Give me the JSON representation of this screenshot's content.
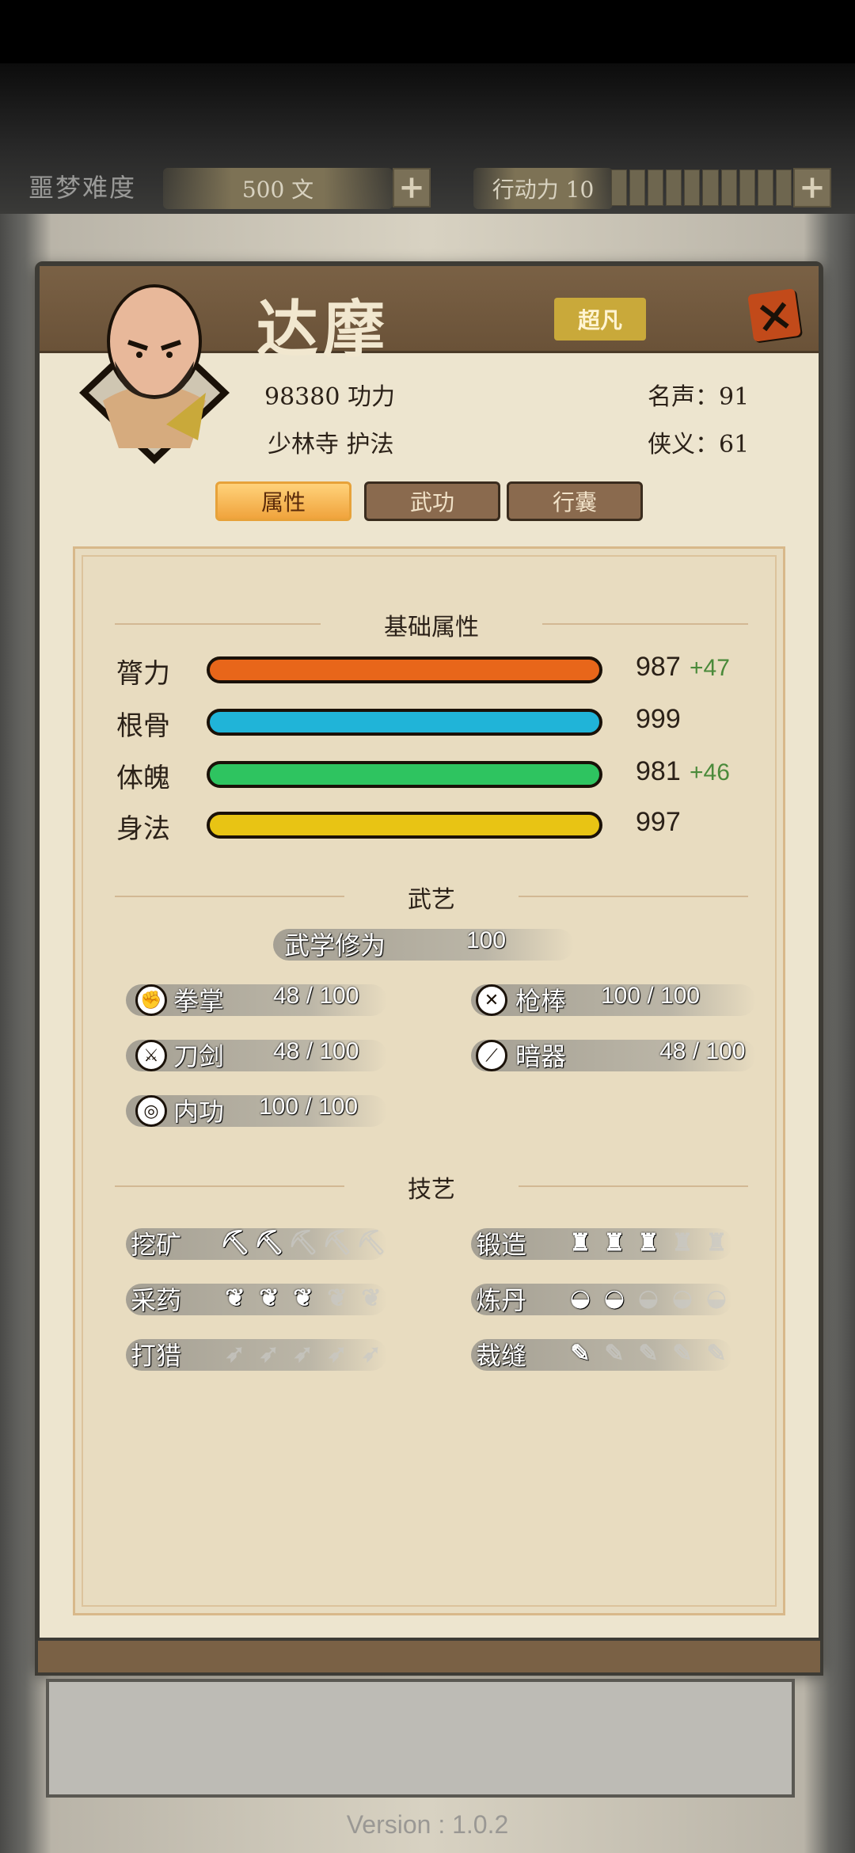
{
  "hud": {
    "difficulty_label": "噩梦难度",
    "money": "500 文",
    "stamina_label": "行动力 10",
    "plus_icon": "plus-icon"
  },
  "character": {
    "name": "达摩",
    "rarity": "超凡",
    "power": "98380 功力",
    "faction": "少林寺 护法",
    "fame": "名声：91",
    "chivalry": "侠义：61"
  },
  "tabs": [
    {
      "label": "属性",
      "active": true
    },
    {
      "label": "武功",
      "active": false
    },
    {
      "label": "行囊",
      "active": false
    }
  ],
  "sections": {
    "base": "基础属性",
    "martial": "武艺",
    "craft": "技艺"
  },
  "stats": [
    {
      "label": "膂力",
      "value": "987",
      "bonus": "+47",
      "color": "#e8661a"
    },
    {
      "label": "根骨",
      "value": "999",
      "bonus": "",
      "color": "#20b4d8"
    },
    {
      "label": "体魄",
      "value": "981",
      "bonus": "+46",
      "color": "#2ec460"
    },
    {
      "label": "身法",
      "value": "997",
      "bonus": "",
      "color": "#e8c414"
    }
  ],
  "mastery": {
    "label": "武学修为",
    "value": "100"
  },
  "skills": [
    {
      "icon": "fist-icon",
      "label": "拳掌",
      "value": "48 / 100"
    },
    {
      "icon": "spear-icon",
      "label": "枪棒",
      "value": "100 / 100"
    },
    {
      "icon": "sword-icon",
      "label": "刀剑",
      "value": "48 / 100"
    },
    {
      "icon": "dart-icon",
      "label": "暗器",
      "value": "48 / 100"
    },
    {
      "icon": "internal-icon",
      "label": "内功",
      "value": "100 / 100"
    }
  ],
  "crafts": [
    {
      "label": "挖矿",
      "icon": "pickaxe-icon",
      "level": 2,
      "max": 5,
      "glyph": "⛏"
    },
    {
      "label": "锻造",
      "icon": "anvil-icon",
      "level": 3,
      "max": 5,
      "glyph": "♜"
    },
    {
      "label": "采药",
      "icon": "herb-icon",
      "level": 3,
      "max": 5,
      "glyph": "❦"
    },
    {
      "label": "炼丹",
      "icon": "mortar-icon",
      "level": 2,
      "max": 5,
      "glyph": "◒"
    },
    {
      "label": "打猎",
      "icon": "bow-icon",
      "level": 0,
      "max": 5,
      "glyph": "➶"
    },
    {
      "label": "裁缝",
      "icon": "needle-icon",
      "level": 1,
      "max": 5,
      "glyph": "✎"
    }
  ],
  "version": "Version : 1.0.2"
}
